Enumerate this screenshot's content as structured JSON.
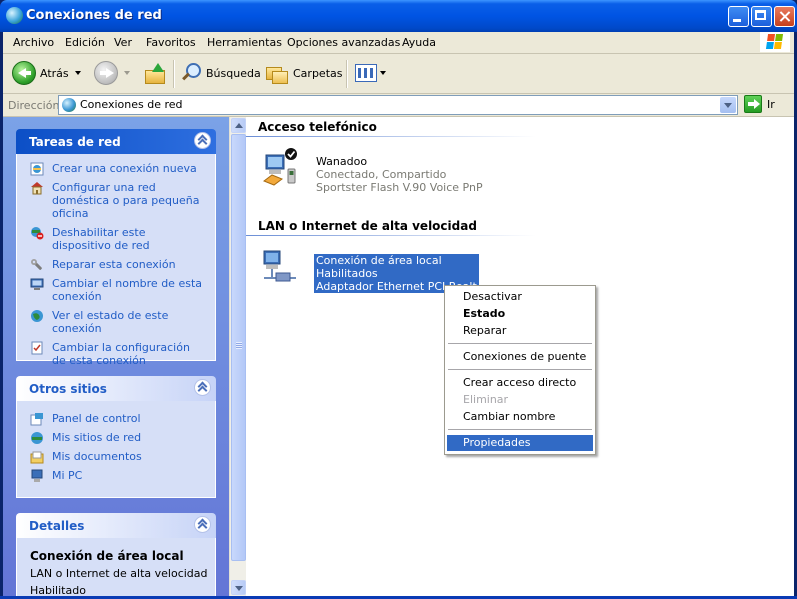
{
  "window": {
    "title": "Conexiones de red"
  },
  "menu": [
    "Archivo",
    "Edición",
    "Ver",
    "Favoritos",
    "Herramientas",
    "Opciones avanzadas",
    "Ayuda"
  ],
  "toolbar": {
    "back_label": "Atrás",
    "search_label": "Búsqueda",
    "folders_label": "Carpetas"
  },
  "address": {
    "label": "Dirección",
    "value": "Conexiones de red",
    "go_label": "Ir"
  },
  "sidebar": {
    "tasks": {
      "title": "Tareas de red",
      "items": [
        "Crear una conexión nueva",
        "Configurar una red doméstica o para pequeña oficina",
        "Deshabilitar este dispositivo de red",
        "Reparar esta conexión",
        "Cambiar el nombre de esta conexión",
        "Ver el estado de este conexión",
        "Cambiar la configuración de esta conexión"
      ]
    },
    "other": {
      "title": "Otros sitios",
      "items": [
        "Panel de control",
        "Mis sitios de red",
        "Mis documentos",
        "Mi PC"
      ]
    },
    "details": {
      "title": "Detalles",
      "name": "Conexión de área local",
      "type": "LAN o Internet de alta velocidad",
      "status": "Habilitado"
    }
  },
  "content": {
    "dialup": {
      "header": "Acceso telefónico",
      "item": {
        "name": "Wanadoo",
        "status": "Conectado, Compartido",
        "device": "Sportster Flash V.90 Voice PnP"
      }
    },
    "lan": {
      "header": "LAN o Internet de alta velocidad",
      "item": {
        "name": "Conexión de área local",
        "status": "Habilitados",
        "device": "Adaptador Ethernet PCI Realt"
      }
    }
  },
  "context_menu": {
    "items": [
      "Desactivar",
      "Estado",
      "Reparar",
      "Conexiones de puente",
      "Crear acceso directo",
      "Eliminar",
      "Cambiar nombre",
      "Propiedades"
    ]
  }
}
